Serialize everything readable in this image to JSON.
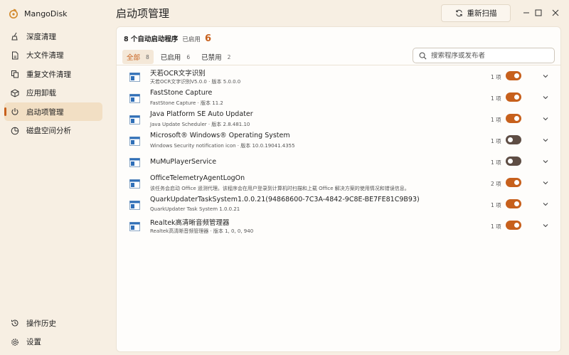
{
  "app": {
    "name": "MangoDisk"
  },
  "sidebar": {
    "items": [
      {
        "label": "深度清理",
        "icon": "sweep-icon",
        "active": false
      },
      {
        "label": "大文件清理",
        "icon": "file-icon",
        "active": false
      },
      {
        "label": "重复文件清理",
        "icon": "copy-icon",
        "active": false
      },
      {
        "label": "应用卸载",
        "icon": "box-icon",
        "active": false
      },
      {
        "label": "启动项管理",
        "icon": "power-icon",
        "active": true
      },
      {
        "label": "磁盘空间分析",
        "icon": "pie-icon",
        "active": false
      }
    ],
    "bottom": [
      {
        "label": "操作历史",
        "icon": "history-icon"
      },
      {
        "label": "设置",
        "icon": "gear-icon"
      }
    ]
  },
  "header": {
    "title": "启动项管理",
    "rescan_label": "重新扫描"
  },
  "summary": {
    "count_text": "8 个自动启动程序",
    "enabled_label": "已启用",
    "enabled_count": "6"
  },
  "tabs": [
    {
      "label": "全部",
      "count": "8",
      "active": true
    },
    {
      "label": "已启用",
      "count": "6",
      "active": false
    },
    {
      "label": "已禁用",
      "count": "2",
      "active": false
    }
  ],
  "search": {
    "placeholder": "搜索程序或发布者"
  },
  "items": [
    {
      "name": "天若OCR文字识别",
      "desc": "天若OCR文字识别V5.0.0 · 版本 5.0.0.0",
      "count": "1 项",
      "enabled": true
    },
    {
      "name": "FastStone Capture",
      "desc": "FastStone Capture · 版本 11.2",
      "count": "1 项",
      "enabled": true
    },
    {
      "name": "Java Platform SE Auto Updater",
      "desc": "Java Update Scheduler · 版本 2.8.481.10",
      "count": "1 项",
      "enabled": true
    },
    {
      "name": "Microsoft® Windows® Operating System",
      "desc": "Windows Security notification icon · 版本 10.0.19041.4355",
      "count": "1 项",
      "enabled": false
    },
    {
      "name": "MuMuPlayerService",
      "desc": "",
      "count": "1 项",
      "enabled": false
    },
    {
      "name": "OfficeTelemetryAgentLogOn",
      "desc": "该任务会启动 Office 遥测代理。该程序会在用户登录到计算机时扫描和上载 Office 解决方案的使用情况和错误信息。",
      "count": "2 项",
      "enabled": true
    },
    {
      "name": "QuarkUpdaterTaskSystem1.0.0.21(94868600-7C3A-4842-9C8E-BE7FE81C9B93)",
      "desc": "QuarkUpdater Task System 1.0.0.21",
      "count": "1 项",
      "enabled": true
    },
    {
      "name": "Realtek高清晰音频管理器",
      "desc": "Realtek高清晰音频管理器 · 版本 1, 0, 0, 940",
      "count": "1 项",
      "enabled": true
    }
  ],
  "colors": {
    "accent": "#c7601c",
    "background": "#f7efe3",
    "toggle_off": "#5e4d44"
  }
}
